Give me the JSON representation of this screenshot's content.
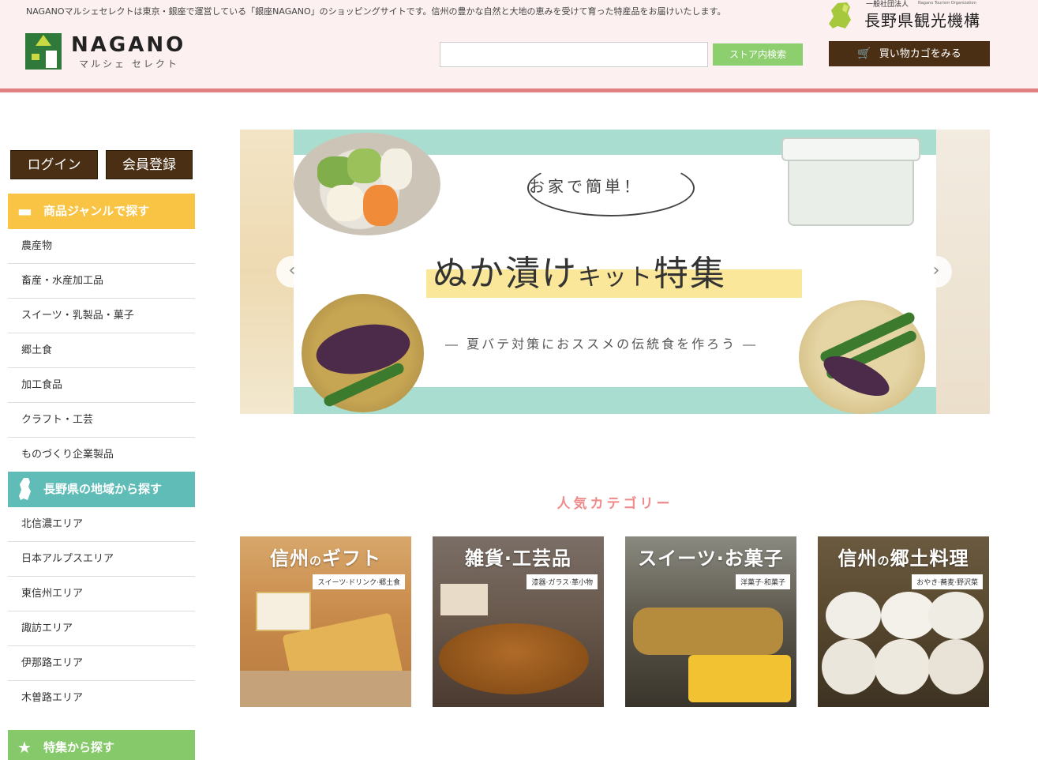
{
  "header": {
    "tagline": "NAGANOマルシェセレクトは東京・銀座で運営している「銀座NAGANO」のショッピングサイトです。信州の豊かな自然と大地の恵みを受けて育った特産品をお届けいたします。",
    "logo_text": "NAGANO",
    "logo_sub": "マルシェ セレクト",
    "search_placeholder": "",
    "search_button": "ストア内検索",
    "cart_button": "買い物カゴをみる",
    "org_small": "一般社団法人",
    "org_small_en": "Nagano Tourism Organization",
    "org_name": "長野県観光機構"
  },
  "sidebar": {
    "login": "ログイン",
    "register": "会員登録",
    "genre_heading": "商品ジャンルで探す",
    "genres": [
      "農産物",
      "畜産・水産加工品",
      "スイーツ・乳製品・菓子",
      "郷土食",
      "加工食品",
      "クラフト・工芸",
      "ものづくり企業製品"
    ],
    "region_heading": "長野県の地域から探す",
    "regions": [
      "北信濃エリア",
      "日本アルプスエリア",
      "東信州エリア",
      "諏訪エリア",
      "伊那路エリア",
      "木曽路エリア"
    ],
    "feature_heading": "特集から探す"
  },
  "banner": {
    "copy_small": "お家で簡単！",
    "title_main": "ぬか漬け",
    "title_small": "キット",
    "title_end": "特集",
    "subtitle": "― 夏バテ対策におススメの伝統食を作ろう ―"
  },
  "popular": {
    "heading": "人気カテゴリー",
    "categories": [
      {
        "title_a": "信州",
        "title_b": "の",
        "title_c": "ギフト",
        "tag": "スイーツ·ドリンク·郷土食"
      },
      {
        "title_a": "雑貨·工芸品",
        "title_b": "",
        "title_c": "",
        "tag": "漆器·ガラス·革小物"
      },
      {
        "title_a": "スイーツ·お菓子",
        "title_b": "",
        "title_c": "",
        "tag": "洋菓子·和菓子"
      },
      {
        "title_a": "信州",
        "title_b": "の",
        "title_c": "郷土料理",
        "tag": "おやき·蕎麦·野沢菜"
      }
    ]
  },
  "colors": {
    "header_bg": "#fcf0f0",
    "header_line": "#e08080",
    "brown": "#4a2f14",
    "green_button": "#8dcf6e",
    "genre_yellow": "#f9c343",
    "region_teal": "#5fbcb7",
    "feature_green": "#86c96a",
    "popular_pink": "#f08a8a"
  }
}
